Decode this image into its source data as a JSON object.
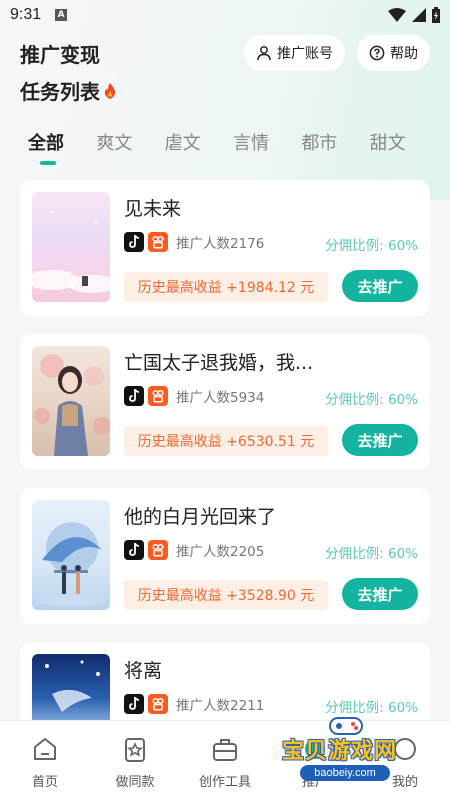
{
  "status_bar": {
    "time": "9:31",
    "notif_letter": "A"
  },
  "header": {
    "title": "推广变现",
    "account_label": "推广账号",
    "help_label": "帮助"
  },
  "section_title": "任务列表",
  "tabs": [
    "全部",
    "爽文",
    "虐文",
    "言情",
    "都市",
    "甜文"
  ],
  "active_tab": "全部",
  "cards": [
    {
      "title": "见未来",
      "promo_count": "推广人数2176",
      "commission": "分佣比例: 60%",
      "earnings": "历史最高收益 +1984.12 元",
      "button": "去推广"
    },
    {
      "title": "亡国太子退我婚，我...",
      "promo_count": "推广人数5934",
      "commission": "分佣比例: 60%",
      "earnings": "历史最高收益 +6530.51 元",
      "button": "去推广"
    },
    {
      "title": "他的白月光回来了",
      "promo_count": "推广人数2205",
      "commission": "分佣比例: 60%",
      "earnings": "历史最高收益 +3528.90 元",
      "button": "去推广"
    },
    {
      "title": "将离",
      "promo_count": "推广人数2211",
      "commission": "分佣比例: 60%",
      "earnings": "",
      "button": ""
    }
  ],
  "bottom_nav": [
    {
      "label": "首页",
      "icon": "home-icon"
    },
    {
      "label": "做同款",
      "icon": "star-card-icon"
    },
    {
      "label": "创作工具",
      "icon": "toolbox-icon"
    },
    {
      "label": "推广",
      "icon": "promote-icon"
    },
    {
      "label": "我的",
      "icon": "profile-icon"
    }
  ],
  "watermark": {
    "text": "宝贝游戏网",
    "url": "baobeiy.com"
  },
  "colors": {
    "accent": "#14b4a0",
    "earn_text": "#f06a2f",
    "earn_bg": "#fdeee6",
    "commission": "#5bc9b9"
  }
}
